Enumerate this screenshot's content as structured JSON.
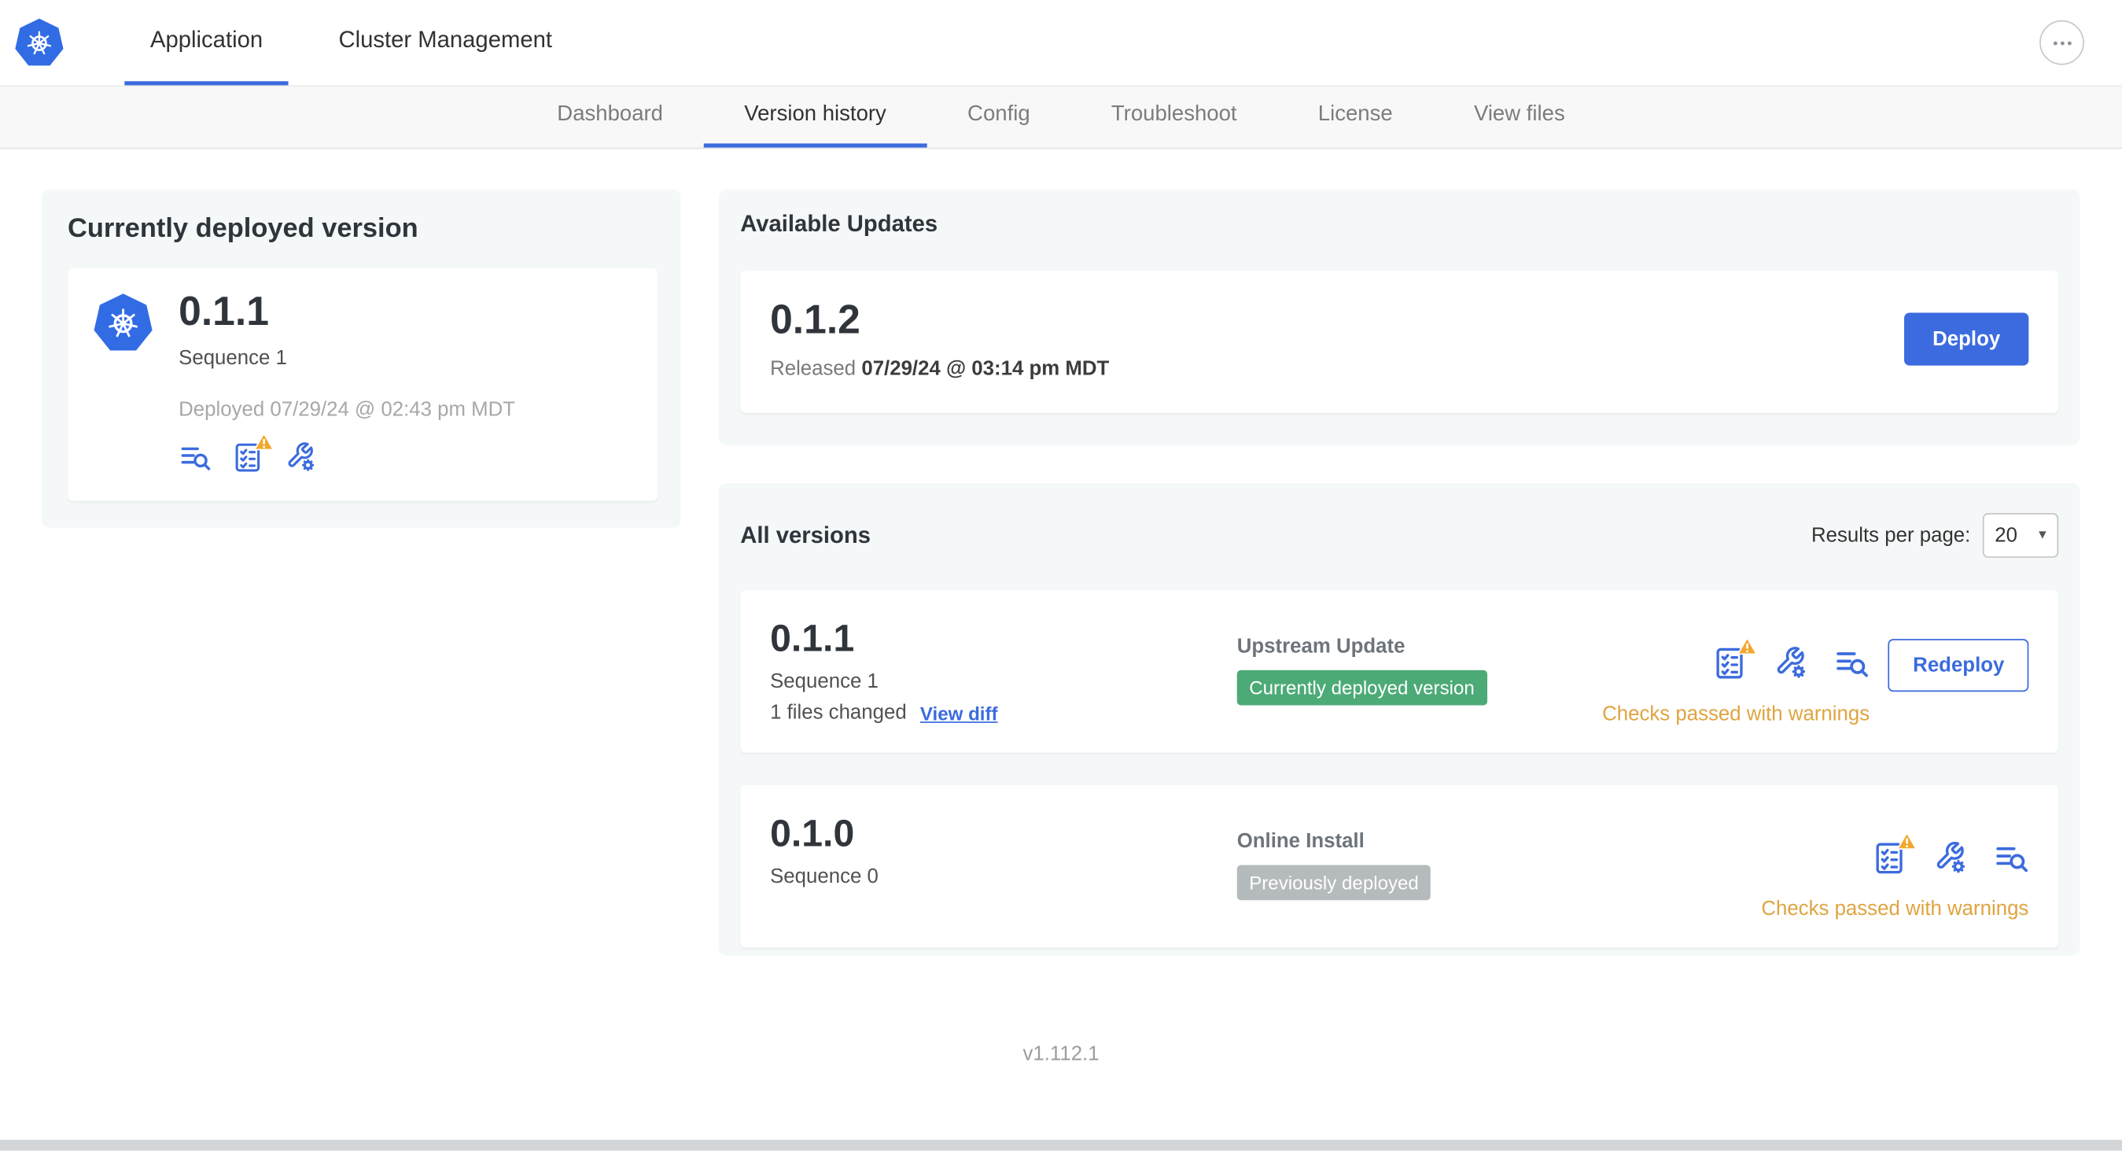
{
  "header": {
    "app_tab": "Application",
    "cluster_tab": "Cluster Management"
  },
  "subnav": {
    "tabs": [
      "Dashboard",
      "Version history",
      "Config",
      "Troubleshoot",
      "License",
      "View files"
    ],
    "active_tab": "Version history"
  },
  "current_version": {
    "title": "Currently deployed version",
    "version": "0.1.1",
    "sequence": "Sequence 1",
    "deployed": "Deployed 07/29/24 @ 02:43 pm MDT"
  },
  "available_updates": {
    "title": "Available Updates",
    "version": "0.1.2",
    "released_label": "Released",
    "released_date": "07/29/24 @ 03:14 pm MDT",
    "deploy_button": "Deploy"
  },
  "all_versions": {
    "title": "All versions",
    "results_label": "Results per page:",
    "results_value": "20",
    "rows": [
      {
        "version": "0.1.1",
        "sequence": "Sequence 1",
        "files_changed": "1 files changed",
        "view_diff": "View diff",
        "source": "Upstream Update",
        "badge": "Currently deployed version",
        "badge_type": "green",
        "status": "Checks passed with warnings",
        "action": "Redeploy"
      },
      {
        "version": "0.1.0",
        "sequence": "Sequence 0",
        "source": "Online Install",
        "badge": "Previously deployed",
        "badge_type": "gray",
        "status": "Checks passed with warnings"
      }
    ]
  },
  "footer": {
    "version": "v1.112.1"
  },
  "icons": {
    "logo": "kubernetes-helm-logo",
    "more": "ellipsis-icon",
    "logs": "view-logs-icon",
    "preflight": "preflight-checklist-icon",
    "config": "config-wrench-icon",
    "warning": "warning-triangle-icon",
    "chevron": "chevron-down-icon"
  },
  "colors": {
    "primary_blue": "#3b6bde",
    "k8s_blue": "#326ce5",
    "green_badge": "#4caa77",
    "gray_badge": "#b5babd",
    "warning_text": "#dfa440",
    "panel_bg": "#f5f8f9"
  }
}
